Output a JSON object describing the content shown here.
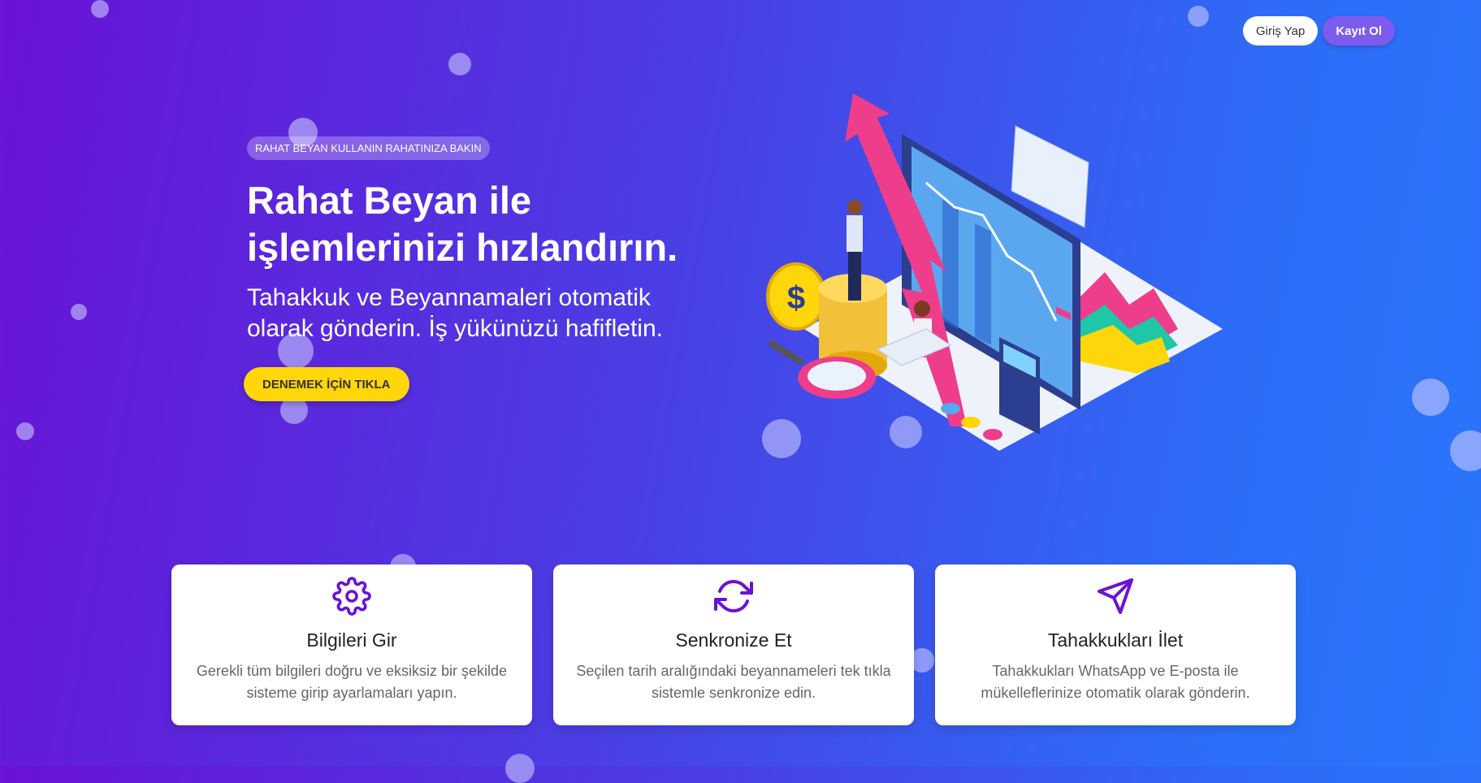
{
  "nav": {
    "login_label": "Giriş Yap",
    "register_label": "Kayıt Ol"
  },
  "hero": {
    "badge": "RAHAT BEYAN KULLANIN RAHATINIZA BAKIN",
    "title_line1": "Rahat Beyan ile",
    "title_line2": "işlemlerinizi hızlandırın.",
    "subtitle_line1": "Tahakkuk ve Beyannamaleri otomatik",
    "subtitle_line2": "olarak gönderin. İş yükünüzü hafifletin.",
    "cta_label": "DENEMEK İÇİN TIKLA"
  },
  "features": [
    {
      "icon": "gear-icon",
      "title": "Bilgileri Gir",
      "description": "Gerekli tüm bilgileri doğru ve eksiksiz bir şekilde sisteme girip ayarlamaları yapın."
    },
    {
      "icon": "sync-icon",
      "title": "Senkronize Et",
      "description": "Seçilen tarih aralığındaki beyannameleri tek tıkla sistemle senkronize edin."
    },
    {
      "icon": "send-icon",
      "title": "Tahakkukları İlet",
      "description": "Tahakkukları WhatsApp ve E-posta ile mükelleflerinize otomatik olarak gönderin."
    }
  ],
  "colors": {
    "accent": "#6a12d6",
    "cta": "#ffd60a",
    "register": "#7d5bee",
    "gradient_start": "#6a12d6",
    "gradient_end": "#2a76fb"
  }
}
